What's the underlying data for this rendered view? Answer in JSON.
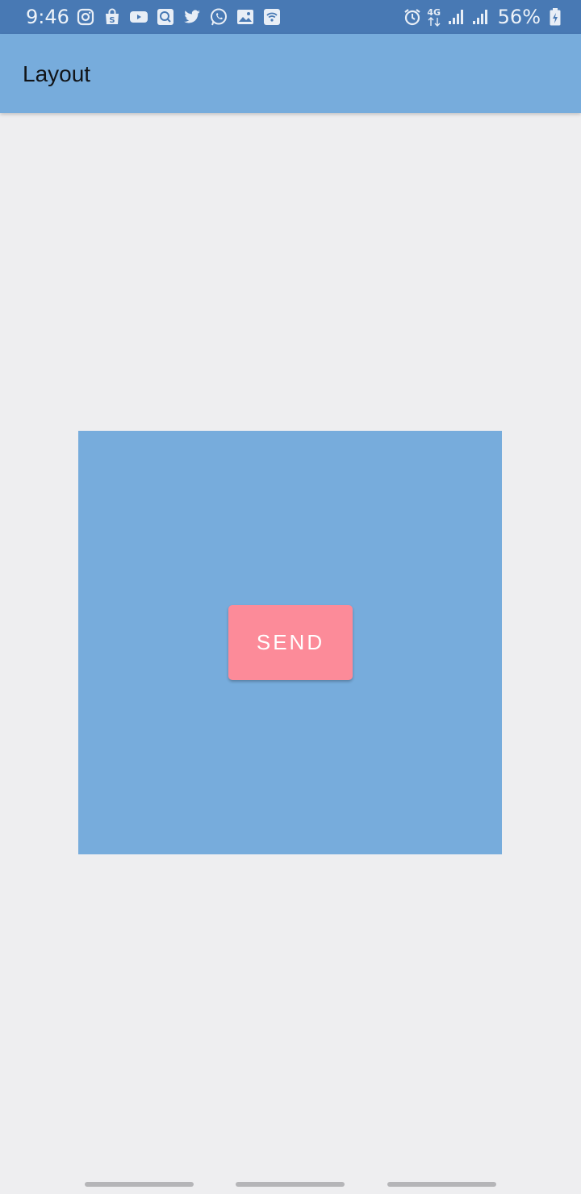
{
  "status_bar": {
    "time": "9:46",
    "network_type": "4G",
    "battery_percent": "56%",
    "left_icons": [
      "instagram-icon",
      "shopping-bag-icon",
      "youtube-icon",
      "messenger-app-icon",
      "twitter-icon",
      "whatsapp-icon",
      "gallery-icon",
      "wifi-hotspot-icon"
    ],
    "right_icons": [
      "alarm-icon",
      "mobile-data-icon",
      "signal-icon",
      "signal-icon",
      "battery-charging-icon"
    ]
  },
  "app_bar": {
    "title": "Layout"
  },
  "main": {
    "send_button_label": "SEND"
  },
  "colors": {
    "status_bar_bg": "#4879b4",
    "app_bar_bg": "#77acdc",
    "content_box_bg": "#77acdc",
    "send_button_bg": "#fc8b99",
    "page_bg": "#eeeef0"
  }
}
